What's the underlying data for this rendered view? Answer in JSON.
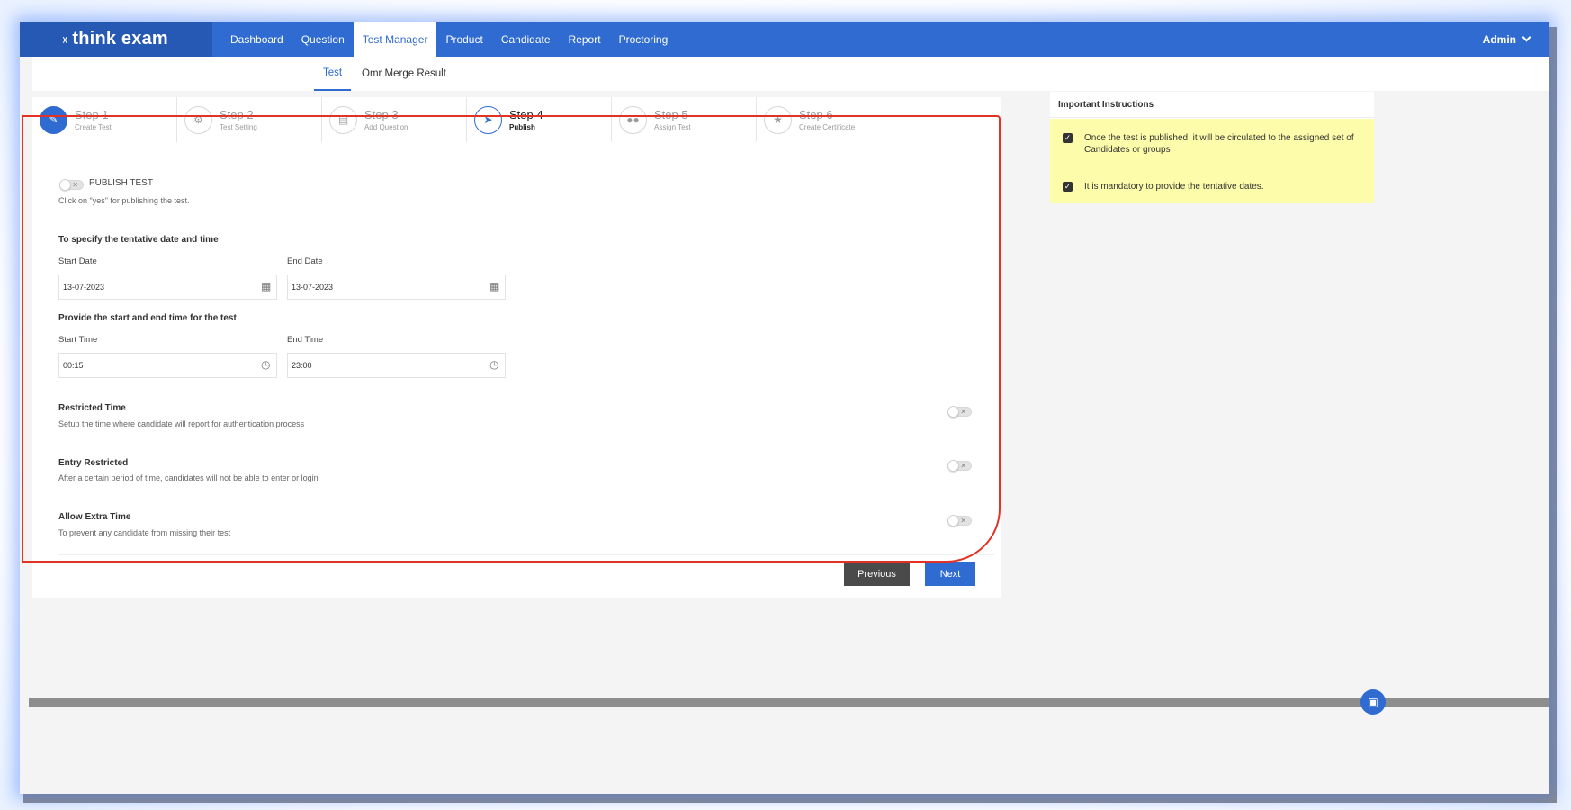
{
  "app": {
    "brand": "think exam"
  },
  "nav": {
    "items": [
      "Dashboard",
      "Question",
      "Test Manager",
      "Product",
      "Candidate",
      "Report",
      "Proctoring"
    ],
    "active": "Test Manager",
    "user": "Admin"
  },
  "subnav": {
    "tabs": [
      "Test",
      "Omr Merge Result"
    ],
    "active": "Test"
  },
  "steps": [
    {
      "title": "Step 1",
      "sub": "Create Test",
      "icon": "pencil-icon"
    },
    {
      "title": "Step 2",
      "sub": "Test Setting",
      "icon": "gear-icon"
    },
    {
      "title": "Step 3",
      "sub": "Add Question",
      "icon": "document-icon"
    },
    {
      "title": "Step 4",
      "sub": "Publish",
      "icon": "rocket-icon"
    },
    {
      "title": "Step 5",
      "sub": "Assign Test",
      "icon": "users-icon"
    },
    {
      "title": "Step 6",
      "sub": "Create Certificate",
      "icon": "star-icon"
    }
  ],
  "publish": {
    "toggle_label": "PUBLISH TEST",
    "hint": "Click on \"yes\" for publishing the test."
  },
  "dates": {
    "heading": "To specify the tentative date and time",
    "start_label": "Start Date",
    "start_value": "13-07-2023",
    "end_label": "End Date",
    "end_value": "13-07-2023"
  },
  "times": {
    "heading": "Provide the start and end time for the test",
    "start_label": "Start Time",
    "start_value": "00:15",
    "end_label": "End Time",
    "end_value": "23:00"
  },
  "options": [
    {
      "title": "Restricted Time",
      "desc": "Setup the time where candidate will report for authentication process"
    },
    {
      "title": "Entry Restricted",
      "desc": "After a certain period of time, candidates will not be able to enter or login"
    },
    {
      "title": "Allow Extra Time",
      "desc": "To prevent any candidate from missing their test"
    }
  ],
  "buttons": {
    "previous": "Previous",
    "next": "Next"
  },
  "instructions": {
    "title": "Important Instructions",
    "items": [
      "Once the test is published, it will be circulated to the assigned set of Candidates or groups",
      "It is mandatory to provide the tentative dates."
    ]
  },
  "colors": {
    "primary": "#2f6bd0",
    "highlight": "#e23226",
    "instructions_bg": "#fcfcaa"
  }
}
